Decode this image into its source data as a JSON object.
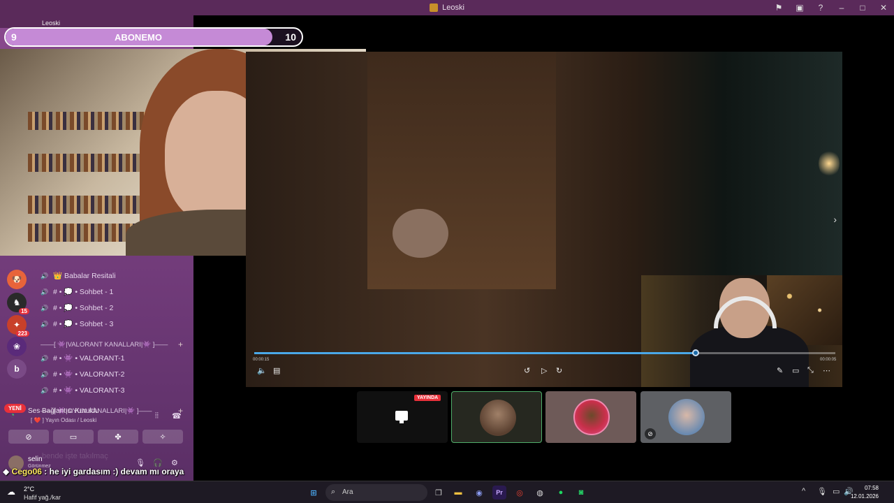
{
  "window": {
    "title": "Leoski",
    "controls": [
      "flag-icon",
      "screen-icon",
      "help-icon",
      "minimize-icon",
      "maximize-icon",
      "close-icon"
    ]
  },
  "stream_overlay": {
    "sub_goal": {
      "current": "9",
      "target": "10",
      "label": "ABONEMO",
      "progress": 0.9
    },
    "tab_label": "Leoski"
  },
  "sidebar": {
    "guild_badges": {
      "g2": "15",
      "g3": "223",
      "g5": "b"
    },
    "yeni_label": "YENİ",
    "channels": [
      {
        "label": "👑 Babalar Resitali"
      },
      {
        "label": "# • 💭 • Sohbet - 1"
      },
      {
        "label": "# • 💭 • Sohbet - 2"
      },
      {
        "label": "# • 💭 • Sohbet - 3"
      }
    ],
    "category_valorant": "——[ 👾|VALORANT KANALLARI|👾 ]——",
    "valorant_channels": [
      {
        "label": "# • 👾 • VALORANT-1"
      },
      {
        "label": "# • 👾 • VALORANT-2"
      },
      {
        "label": "# • 👾 • VALORANT-3"
      }
    ],
    "category_oyun": "——[ 👾|OYUN KANALLARI|👾 ]——",
    "voice": {
      "status": "Ses Bağlantısı Kuruldu",
      "sub": "[ ❤️ ] Yayın Odası / Leoski"
    },
    "user": {
      "name": "selin",
      "status": "Görünmez"
    }
  },
  "player": {
    "time_current": "00:00:15",
    "time_end": "00:00:05",
    "progress": 0.76
  },
  "tiles": {
    "live_label": "YAYINDA"
  },
  "chat": {
    "user": "Cego06",
    "message": ": he iyi gardasım :) devam mı oraya",
    "ghost": "bende işte takılmaç"
  },
  "taskbar": {
    "weather_temp": "2°C",
    "weather_desc": "Hafif yağ./kar",
    "search_placeholder": "Ara",
    "discord_badge": "9+",
    "whatsapp_badge": "10",
    "time": "07:58",
    "date": "12.01.2026"
  },
  "colors": {
    "sidebar": "#7a4080",
    "accent_live": "#e8303a",
    "progress": "#4aa8e8",
    "speaking": "#4fae6a"
  }
}
